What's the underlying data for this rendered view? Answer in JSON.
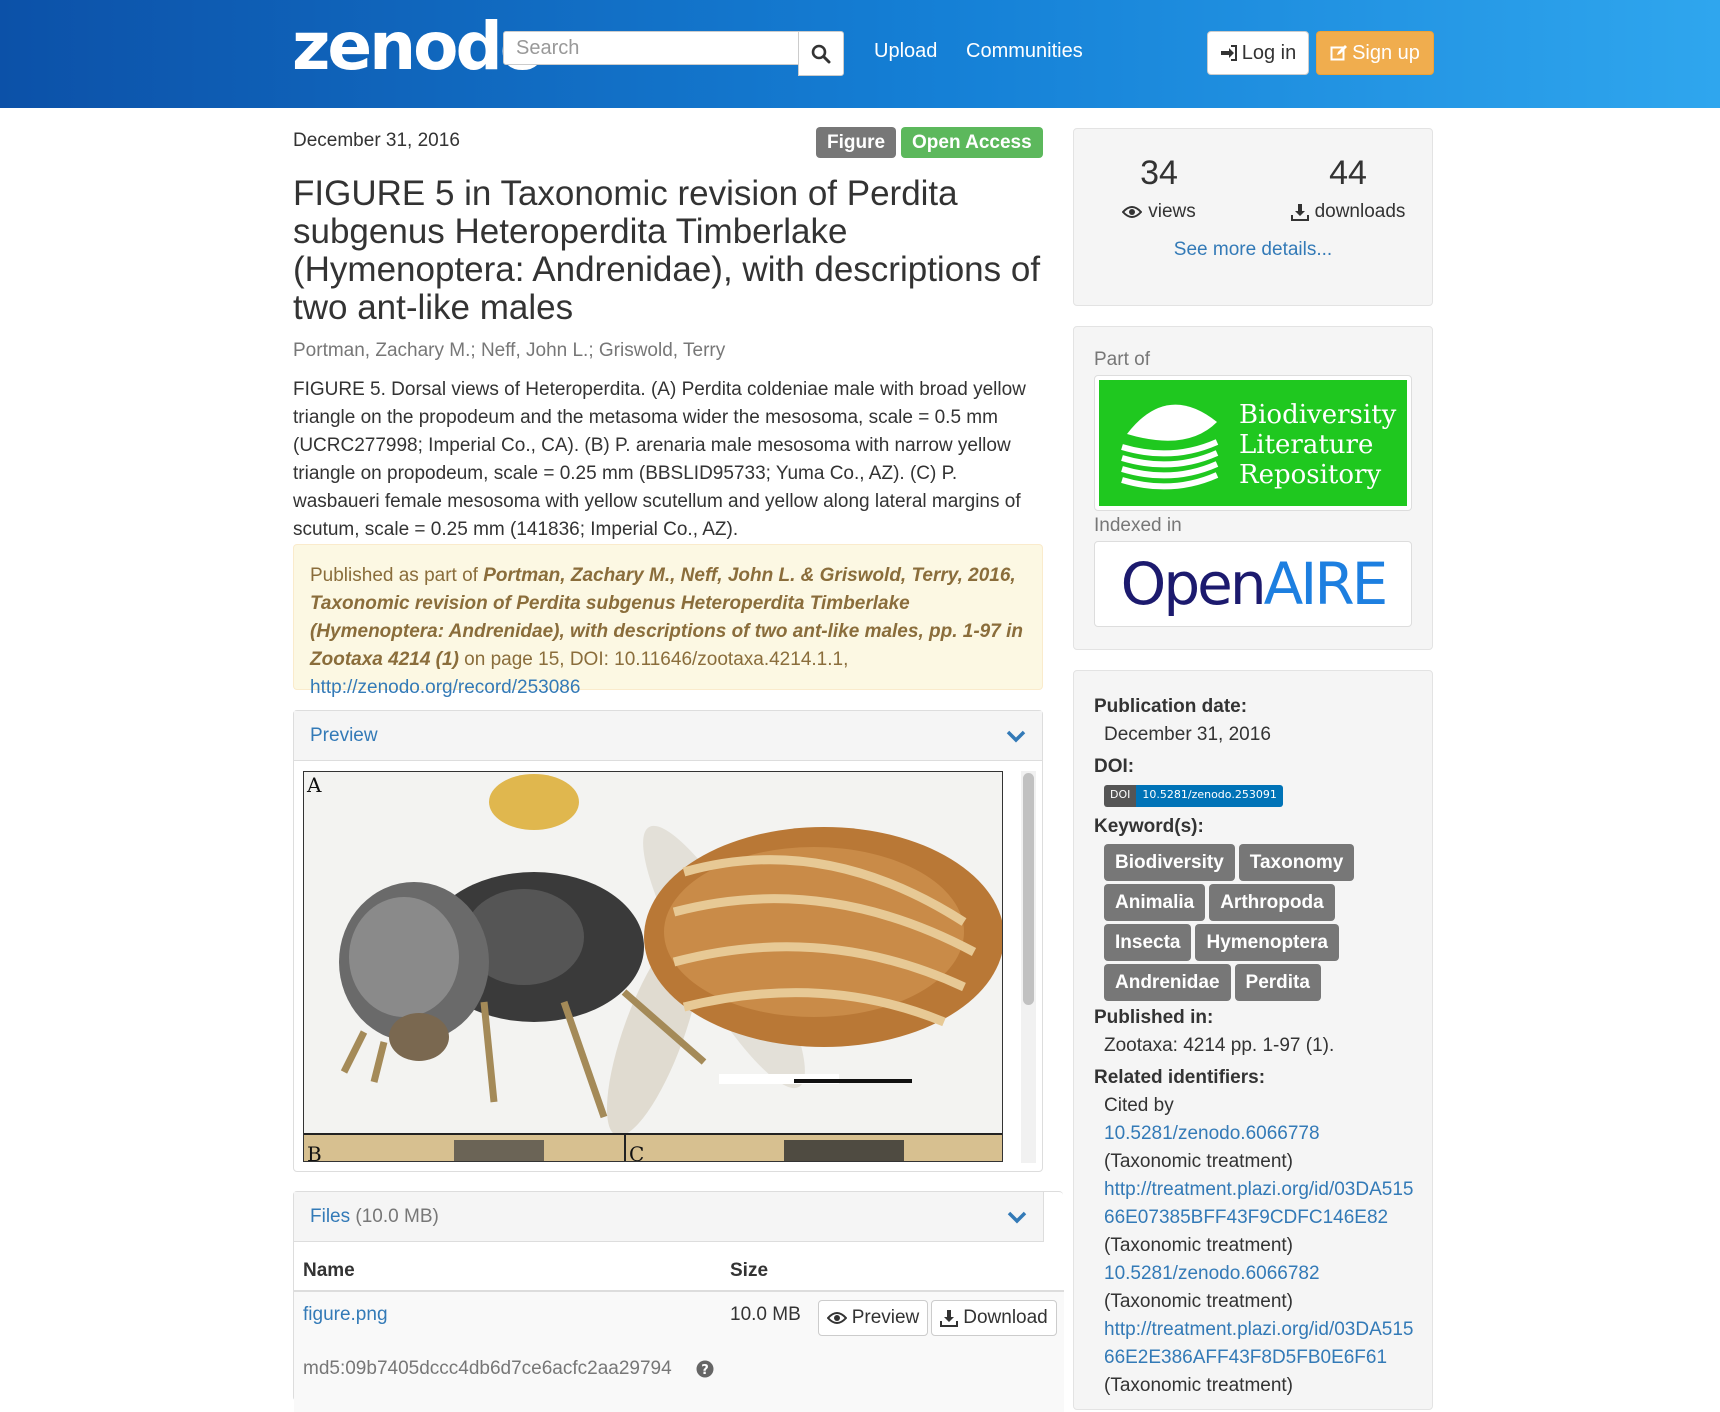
{
  "header": {
    "logo": "zenodo",
    "search_placeholder": "Search",
    "nav": [
      "Upload",
      "Communities"
    ],
    "login_label": "Log in",
    "signup_label": "Sign up"
  },
  "record": {
    "date": "December 31, 2016",
    "badges": [
      {
        "label": "Figure",
        "color": "#777777"
      },
      {
        "label": "Open Access",
        "color": "#5cb85c"
      }
    ],
    "title": "FIGURE 5 in Taxonomic revision of Perdita subgenus Heteroperdita Timberlake (Hymenoptera: Andrenidae), with descriptions of two ant-like males",
    "authors": "Portman, Zachary M.; Neff, John L.; Griswold, Terry",
    "description": "FIGURE 5. Dorsal views of Heteroperdita. (A) Perdita coldeniae male with broad yellow triangle on the propodeum and the metasoma wider the mesosoma, scale = 0.5 mm (UCRC277998; Imperial Co., CA). (B) P. arenaria male mesosoma with narrow yellow triangle on propodeum, scale = 0.25 mm (BBSLID95733; Yuma Co., AZ). (C) P. wasbaueri female mesosoma with yellow scutellum and yellow along lateral margins of scutum, scale = 0.25 mm (141836; Imperial Co., AZ).",
    "published_prefix": "Published as part of ",
    "published_citation": "Portman, Zachary M., Neff, John L. & Griswold, Terry, 2016, Taxonomic revision of Perdita subgenus Heteroperdita Timberlake (Hymenoptera: Andrenidae), with descriptions of two ant-like males, pp. 1-97 in Zootaxa 4214 (1)",
    "published_suffix": " on page 15, DOI: 10.11646/zootaxa.4214.1.1, ",
    "published_link": "http://zenodo.org/record/253086"
  },
  "preview": {
    "heading": "Preview",
    "panel_letters": [
      "A",
      "B",
      "C"
    ]
  },
  "files": {
    "heading": "Files",
    "size_total": "(10.0 MB)",
    "col_name": "Name",
    "col_size": "Size",
    "rows": [
      {
        "name": "figure.png",
        "size": "10.0 MB",
        "md5": "md5:09b7405dccc4db6d7ce6acfc2aa29794"
      }
    ],
    "preview_btn": "Preview",
    "download_btn": "Download"
  },
  "stats": {
    "views": "34",
    "views_label": "views",
    "downloads": "44",
    "downloads_label": "downloads",
    "more": "See more details..."
  },
  "communities": {
    "part_of": "Part of",
    "bhl_lines": [
      "Biodiversity",
      "Literature",
      "Repository"
    ],
    "indexed_in": "Indexed in",
    "openaire_open": "Open",
    "openaire_aire": "AIRE"
  },
  "meta": {
    "pubdate_label": "Publication date:",
    "pubdate": "December 31, 2016",
    "doi_label": "DOI:",
    "doi_prefix": "DOI",
    "doi": "10.5281/zenodo.253091",
    "keywords_label": "Keyword(s):",
    "keywords": [
      "Biodiversity",
      "Taxonomy",
      "Animalia",
      "Arthropoda",
      "Insecta",
      "Hymenoptera",
      "Andrenidae",
      "Perdita"
    ],
    "published_in_label": "Published in:",
    "published_in": "Zootaxa: 4214 pp. 1-97 (1).",
    "related_label": "Related identifiers:",
    "cited_by": "Cited by",
    "related": [
      {
        "link": "10.5281/zenodo.6066778",
        "type": "(Taxonomic treatment)"
      },
      {
        "link": "http://treatment.plazi.org/id/03DA51566E07385BFF43F9CDFC146E82",
        "type": "(Taxonomic treatment)"
      },
      {
        "link": "10.5281/zenodo.6066782",
        "type": "(Taxonomic treatment)"
      },
      {
        "link": "http://treatment.plazi.org/id/03DA51566E2E386AFF43F8D5FB0E6F61",
        "type": "(Taxonomic treatment)"
      }
    ]
  }
}
